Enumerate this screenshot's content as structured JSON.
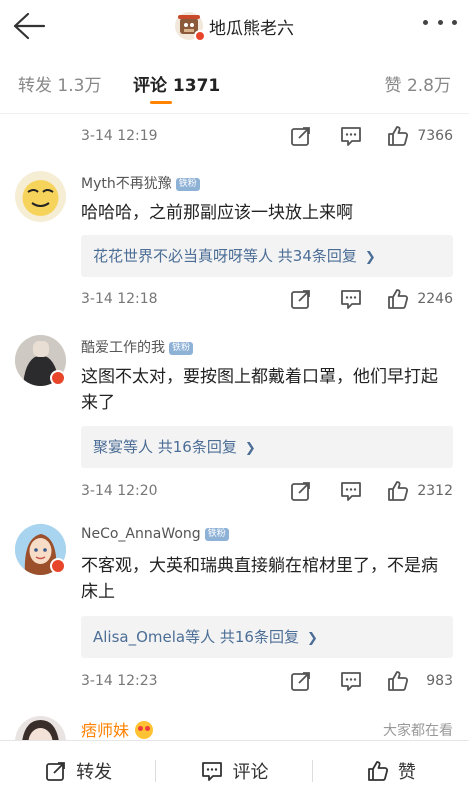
{
  "header": {
    "title": "地瓜熊老六",
    "back_icon": "arrow-left-icon",
    "more_icon": "more-dots-icon"
  },
  "tabs": {
    "repost": "转发 1.3万",
    "comment": "评论 1371",
    "like": "赞 2.8万",
    "accent": "#ff8200"
  },
  "top_partial": {
    "time": "3-14 12:19",
    "likes": "7366"
  },
  "comments": [
    {
      "name": "Myth不再犹豫",
      "fan_badge": "铁粉",
      "text": "哈哈哈，之前那副应该一块放上来啊",
      "reply": "花花世界不必当真呀呀等人  共34条回复",
      "time": "3-14 12:18",
      "likes": "2246"
    },
    {
      "name": "酷爱工作的我",
      "fan_badge": "铁粉",
      "text": "这图不太对，要按图上都戴着口罩，他们早打起来了",
      "reply": "聚宴等人  共16条回复",
      "time": "3-14 12:20",
      "likes": "2312"
    },
    {
      "name": "NeCo_AnnaWong",
      "fan_badge": "铁粉",
      "text": "不客观，大英和瑞典直接躺在棺材里了，不是病床上",
      "reply": "Alisa_Omela等人  共16条回复",
      "time": "3-14 12:23",
      "likes": "983"
    }
  ],
  "peek": {
    "name": "痞师妹",
    "tag": "大家都在看"
  },
  "bottombar": {
    "repost": "转发",
    "comment": "评论",
    "like": "赞"
  }
}
